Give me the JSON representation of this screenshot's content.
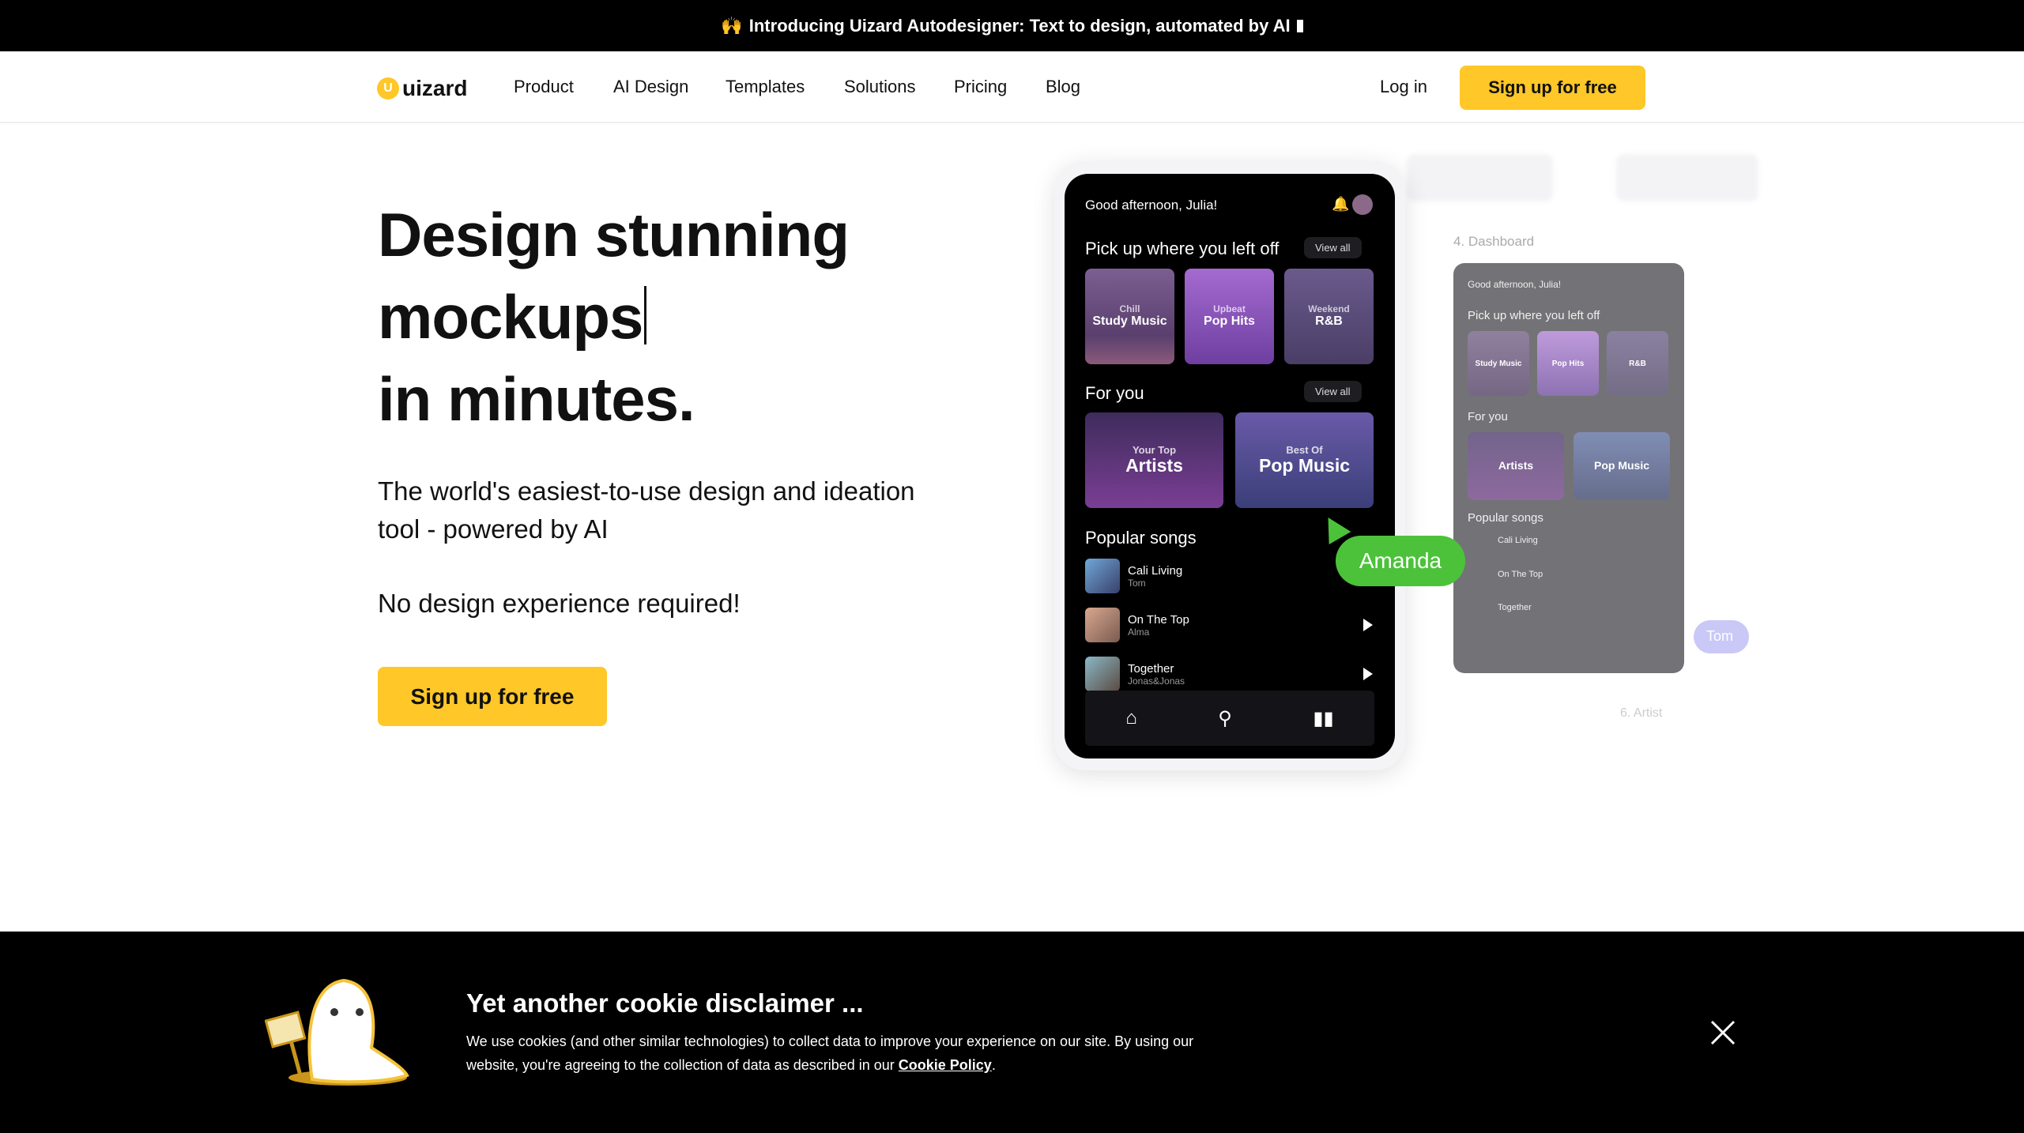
{
  "announcement": {
    "icon": "raised-hands-icon",
    "text": "Introducing Uizard Autodesigner: Text to design, automated by AI"
  },
  "nav": {
    "logo": "uizard",
    "items": [
      "Product",
      "AI Design",
      "Templates",
      "Solutions",
      "Pricing",
      "Blog"
    ],
    "login": "Log in",
    "signup": "Sign up for free"
  },
  "hero": {
    "line1": "Design stunning",
    "line2": "mockups",
    "line3": "in minutes.",
    "subtitle": "The world's easiest-to-use design and ideation tool - powered by AI",
    "note": "No design experience required!",
    "cta": "Sign up for free"
  },
  "mockup": {
    "greeting": "Good afternoon, Julia!",
    "section1": "Pick up where you left off",
    "view_all": "View all",
    "cards": [
      {
        "small": "Chill",
        "big": "Study Music"
      },
      {
        "small": "Upbeat",
        "big": "Pop Hits"
      },
      {
        "small": "Weekend",
        "big": "R&B"
      }
    ],
    "section2": "For you",
    "big_cards": [
      {
        "small": "Your Top",
        "big": "Artists"
      },
      {
        "small": "Best Of",
        "big": "Pop Music"
      }
    ],
    "section3": "Popular songs",
    "songs": [
      {
        "title": "Cali Living",
        "artist": "Tom"
      },
      {
        "title": "On The Top",
        "artist": "Alma"
      },
      {
        "title": "Together",
        "artist": "Jonas&Jonas"
      }
    ],
    "cursor_label": "Amanda",
    "screen_label": "4. Dashboard",
    "screen_label2": "6. Artist",
    "cursor_label2": "Tom"
  },
  "cookie": {
    "title": "Yet another cookie disclaimer ...",
    "text": "We use cookies (and other similar technologies) to collect data to improve your experience on our site. By using our website, you're agreeing to the collection of data as described in our ",
    "link": "Cookie Policy",
    "end": "."
  },
  "colors": {
    "accent": "#ffc727",
    "cursor": "#4cc23a"
  }
}
